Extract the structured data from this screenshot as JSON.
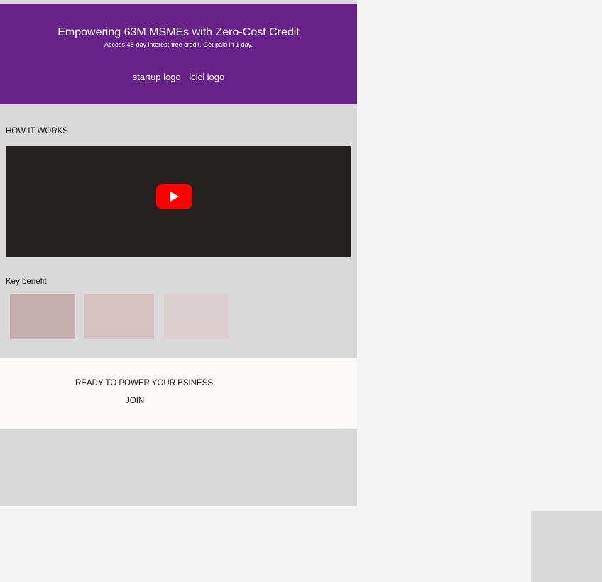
{
  "hero": {
    "title": "Empowering 63M MSMEs with Zero-Cost Credit",
    "subtitle": "Access 48-day interest-free credit. Get paid in 1 day.",
    "logos": [
      "startup logo",
      "icici logo"
    ],
    "background_color": "#662288"
  },
  "how_it_works": {
    "title": "HOW IT WORKS",
    "video": {
      "icon": "youtube-play-icon",
      "play_color": "#ff0000"
    }
  },
  "key_benefit": {
    "title": "Key benefit",
    "card_colors": [
      "#c4aeb0",
      "#d6c1c3",
      "#dccfd0"
    ]
  },
  "cta": {
    "title": "READY TO POWER YOUR BSINESS",
    "join_label": "JOIN"
  }
}
